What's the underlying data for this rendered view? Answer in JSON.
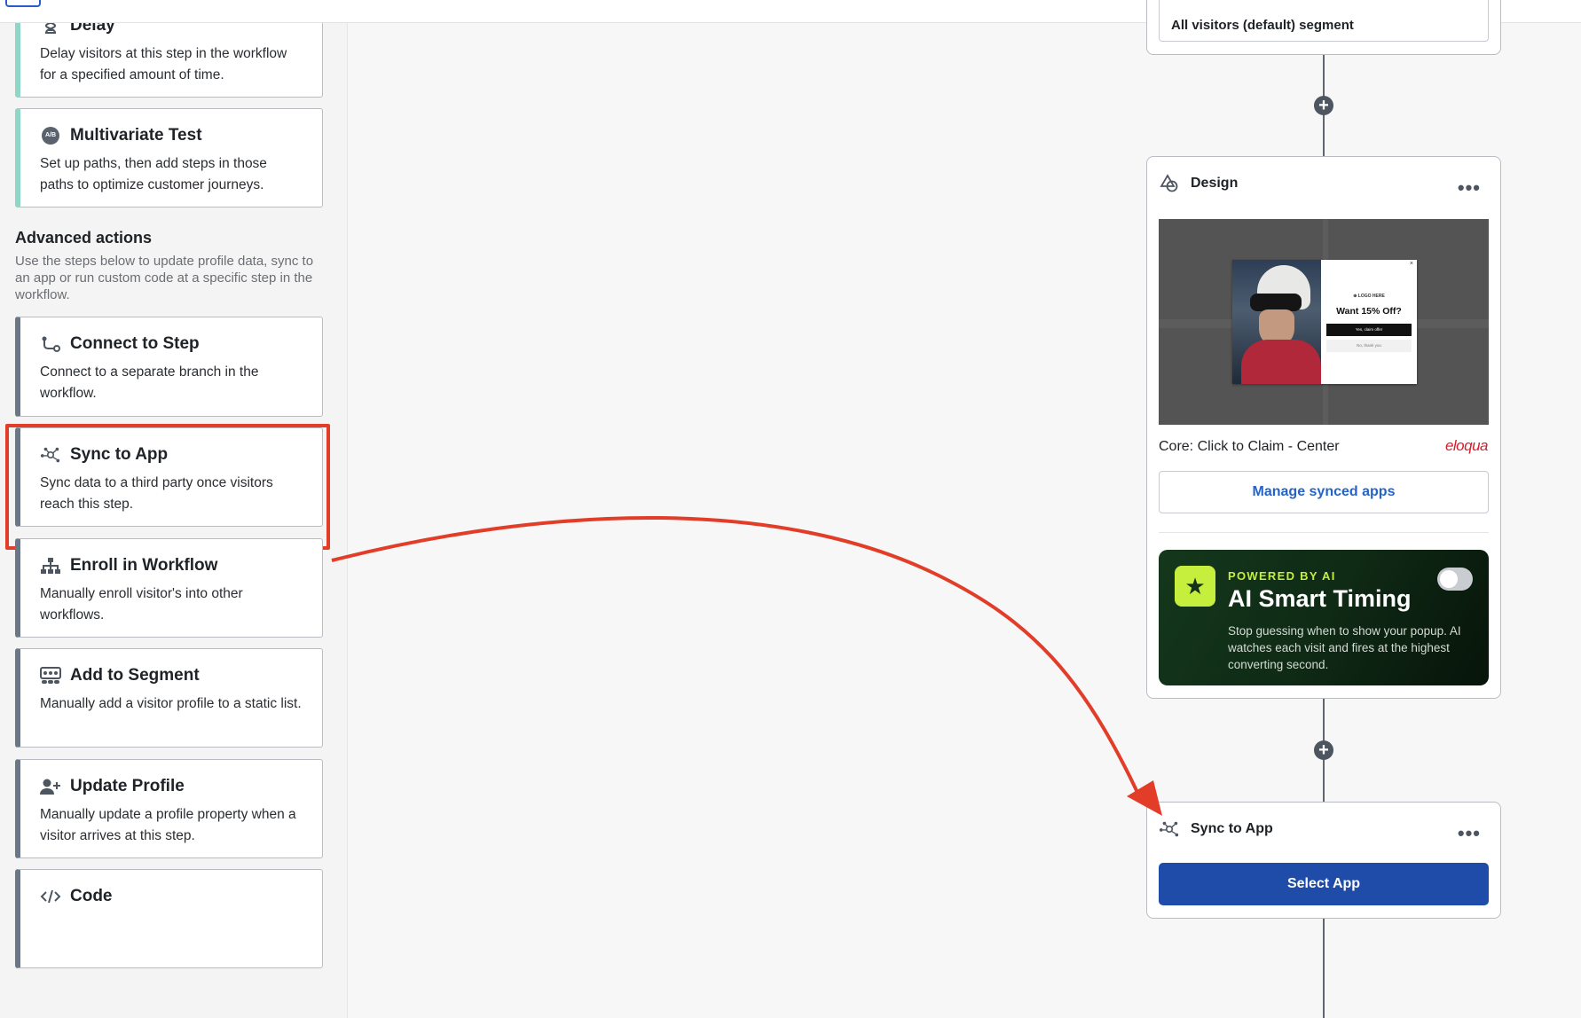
{
  "sidebar": {
    "cards": [
      {
        "title": "Delay",
        "desc": "Delay visitors at this step in the workflow for a specified amount of time.",
        "icon": "hourglass-icon"
      },
      {
        "title": "Multivariate Test",
        "desc": "Set up paths, then add steps in those paths to optimize customer journeys.",
        "icon": "ab-test-icon",
        "icon_text": "A/B"
      },
      {
        "title": "Connect to Step",
        "desc": "Connect to a separate branch in the workflow.",
        "icon": "connect-step-icon"
      },
      {
        "title": "Sync to App",
        "desc": "Sync data to a third party once visitors reach this step.",
        "icon": "sync-network-icon"
      },
      {
        "title": "Enroll in Workflow",
        "desc": "Manually enroll visitor's into other workflows.",
        "icon": "hierarchy-icon"
      },
      {
        "title": "Add to Segment",
        "desc": "Manually add a visitor profile to a static list.",
        "icon": "segment-group-icon"
      },
      {
        "title": "Update Profile",
        "desc": "Manually update a profile property when a visitor arrives at this step.",
        "icon": "user-plus-icon"
      },
      {
        "title": "Code",
        "icon": "code-icon"
      }
    ],
    "section": {
      "title": "Advanced actions",
      "desc": "Use the steps below to update profile data, sync to an app or run custom code at a specific step in the workflow."
    }
  },
  "canvas": {
    "segment_node_text": "All visitors (default) segment",
    "design_node": {
      "title": "Design",
      "menu": "•••",
      "popup": {
        "logo": "⊕ LOGO HERE",
        "offer": "Want 15% Off?",
        "claim": "Yes, claim offer",
        "decline": "No, thank you",
        "close": "×"
      },
      "template_name": "Core: Click to Claim - Center",
      "brand": "eloqua",
      "manage_button": "Manage synced apps",
      "ai_card": {
        "eyebrow": "POWERED BY AI",
        "title": "AI Smart Timing",
        "body": "Stop guessing when to show your popup. AI watches each visit and fires at the highest converting second.",
        "toggle_on": false
      }
    },
    "sync_node": {
      "title": "Sync to App",
      "menu": "•••",
      "button": "Select App"
    },
    "plus_symbol": "+"
  },
  "colors": {
    "highlight": "#e23d28",
    "primary_button": "#1e4ca8",
    "link": "#2563c9",
    "ai_accent": "#c6ee3c",
    "brand": "#d31f2c"
  }
}
